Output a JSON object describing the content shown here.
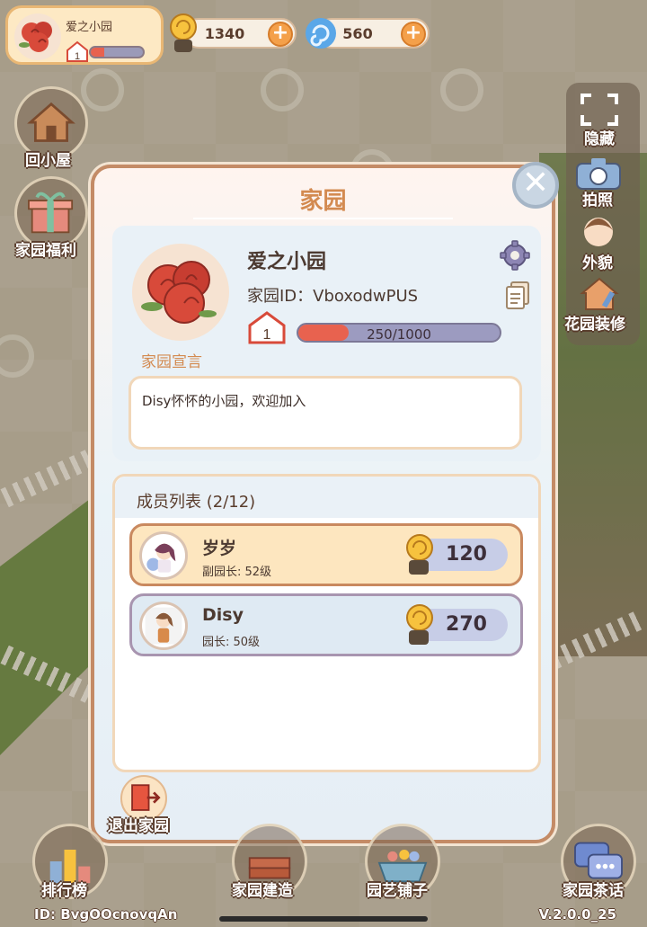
{
  "hud": {
    "home_name": "爱之小园",
    "home_level": "1",
    "home_level_progress": 0.25,
    "snail_coins": "1340",
    "spirals": "560"
  },
  "left_menu": {
    "cabin_label": "回小屋",
    "welfare_label": "家园福利"
  },
  "right_menu": {
    "hide_label": "隐藏",
    "photo_label": "拍照",
    "appearance_label": "外貌",
    "decorate_label": "花园装修"
  },
  "modal": {
    "title": "家园",
    "home_name": "爱之小园",
    "home_id": "家园ID：VboxodwPUS",
    "declaration_label": "家园宣言",
    "level": "1",
    "exp_text": "250/1000",
    "exp_progress": 0.25,
    "declaration_text": "Disy怀怀的小园，欢迎加入",
    "members_title": "成员列表 (2/12)",
    "members": [
      {
        "name": "岁岁",
        "role": "副园长: 52级",
        "score": "120",
        "style": "gold"
      },
      {
        "name": "Disy",
        "role": "园长: 50级",
        "score": "270",
        "style": "blue"
      }
    ],
    "exit_label": "退出家园"
  },
  "bottom_menu": {
    "rank_label": "排行榜",
    "build_label": "家园建造",
    "shop_label": "园艺铺子",
    "tea_label": "家园茶话"
  },
  "footer": {
    "player_id": "ID:  BvgOOcnovqAn",
    "version": "V.2.0.0_25"
  },
  "colors": {
    "accent_orange": "#d38a50",
    "exp_red": "#e8624f",
    "frame_brown": "#c48b66"
  }
}
